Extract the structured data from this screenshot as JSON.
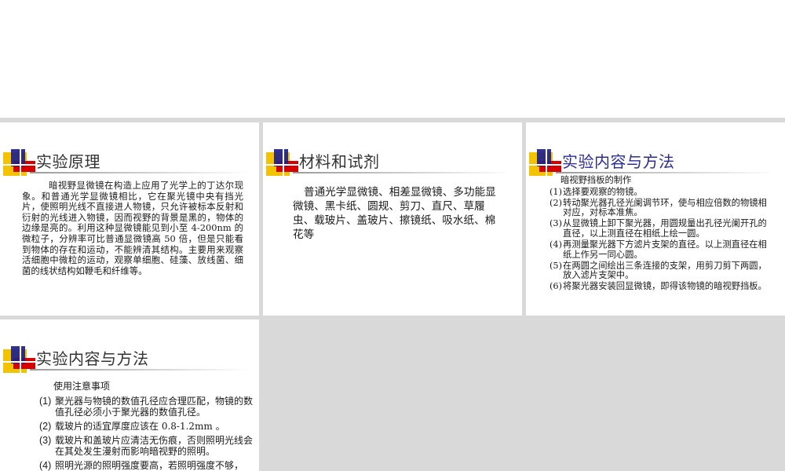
{
  "slides": {
    "principle": {
      "title": "实验原理",
      "body": "暗视野显微镜在构造上应用了光学上的丁达尔现象。和普通光学显微镜相比，它在聚光镜中央有挡光片，使照明光线不直接进人物镜，只允许被标本反射和衍射的光线进入物镜，因而视野的背景是黑的，物体的边缘是亮的。利用这种显微镜能见到小至 4-200nm 的微粒子，分辨率可比普通显微镜高 50 倍，但是只能看到物体的存在和运动，不能辨清其结构。主要用来观察活细胞中微粒的运动，观察单细胞、硅藻、放线菌、细菌的线状结构如鞭毛和纤维等。"
    },
    "materials": {
      "title": "材料和试剂",
      "body": "普通光学显微镜、相差显微镜、多功能显微镜、黑卡纸、圆规、剪刀、直尺、草履虫、载玻片、盖玻片、擦镜纸、吸水纸、棉花等"
    },
    "methods1": {
      "title": "实验内容与方法",
      "heading": "暗视野挡板的制作",
      "items": [
        {
          "num": "(1)",
          "text": "选择要观察的物镜。"
        },
        {
          "num": "(2)",
          "text": "转动聚光器孔径光阑调节环，使与相应倍数的物镜相对应，对标本准焦。"
        },
        {
          "num": "(3)",
          "text": "从显微镜上卸下聚光器，用圆规量出孔径光阑开孔的直径，以上测直径在相纸上绘一圆。"
        },
        {
          "num": "(4)",
          "text": "再测量聚光器下方滤片支架的直径。以上测直径在相纸上作另一同心圆。"
        },
        {
          "num": "(5)",
          "text": "在两圆之间绘出三条连接的支架，用剪刀剪下两圆，放入滤片支架中。"
        },
        {
          "num": "(6)",
          "text": "将聚光器安装回显微镜，即得该物镜的暗视野挡板。"
        }
      ]
    },
    "methods2": {
      "title": "实验内容与方法",
      "heading": "使用注意事项",
      "items": [
        {
          "num": "(1)",
          "text": "聚光器与物镜的数值孔径应合理匹配，物镜的数值孔径必须小于聚光器的数值孔径。"
        },
        {
          "num": "(2)",
          "text": "载玻片的适宜厚度应该在 0.8-1.2mm 。"
        },
        {
          "num": "(3)",
          "text": "载玻片和盖玻片应清洁无伤痕，否则照明光线会在其处发生漫射而影响暗视野的照明。"
        },
        {
          "num": "(4)",
          "text": "照明光源的照明强度要高，若照明强度不够，"
        }
      ]
    }
  },
  "colors": {
    "logo_yellow": "#f3c200",
    "logo_red": "#d60000",
    "logo_blue": "#20208a",
    "title_blue": "#2b2b9a"
  }
}
